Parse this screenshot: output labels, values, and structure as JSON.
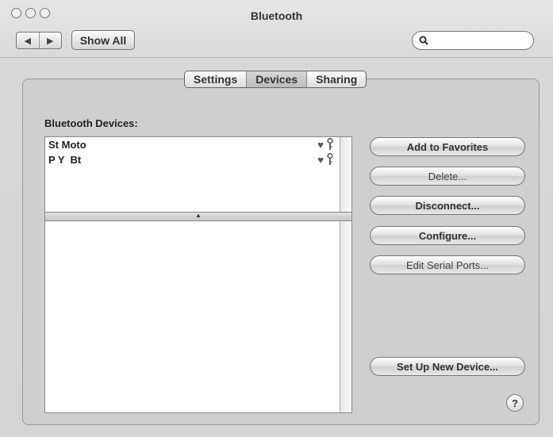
{
  "window": {
    "title": "Bluetooth"
  },
  "toolbar": {
    "back_glyph": "◀",
    "forward_glyph": "▶",
    "show_all_label": "Show All",
    "search_placeholder": ""
  },
  "tabs": [
    {
      "label": "Settings",
      "active": false
    },
    {
      "label": "Devices",
      "active": true
    },
    {
      "label": "Sharing",
      "active": false
    }
  ],
  "devices_section": {
    "label": "Bluetooth Devices:",
    "devices": [
      {
        "name": "St Moto",
        "favorite_icon": "heart-icon",
        "paired_icon": "key-icon"
      },
      {
        "name": "P Y  Bt",
        "favorite_icon": "heart-icon",
        "paired_icon": "key-icon"
      }
    ]
  },
  "actions": {
    "add_to_favorites": "Add to Favorites",
    "delete": "Delete...",
    "disconnect": "Disconnect...",
    "configure": "Configure...",
    "edit_serial_ports": "Edit Serial Ports...",
    "set_up_new_device": "Set Up New Device..."
  },
  "help": {
    "glyph": "?"
  }
}
